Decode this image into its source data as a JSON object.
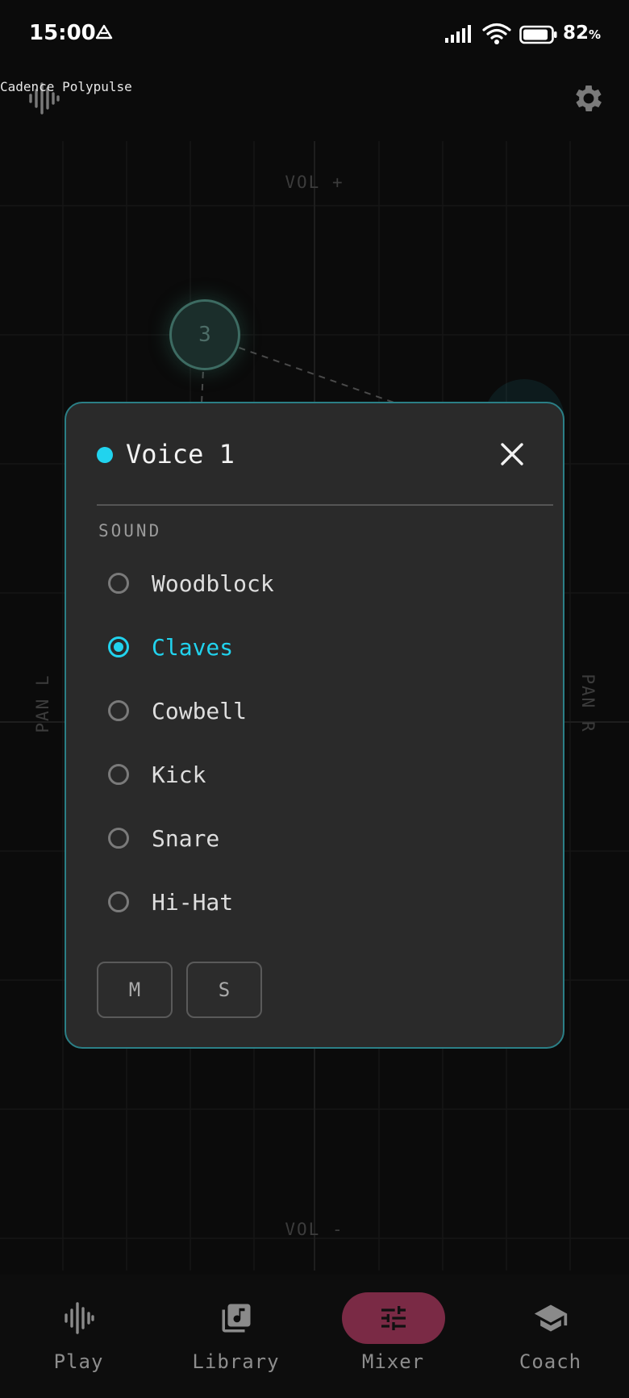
{
  "status_bar": {
    "time": "15:00",
    "battery_percent": "82",
    "battery_unit": "%"
  },
  "header": {
    "title": "Cadence Polypulse"
  },
  "mixer": {
    "axes": {
      "vol_plus": "VOL +",
      "vol_minus": "VOL -",
      "pan_left": "PAN L",
      "pan_right": "PAN R"
    },
    "node_label": "3"
  },
  "dialog": {
    "title": "Voice 1",
    "accent": "#21d3ee",
    "section_label": "SOUND",
    "options": [
      {
        "label": "Woodblock",
        "selected": false
      },
      {
        "label": "Claves",
        "selected": true
      },
      {
        "label": "Cowbell",
        "selected": false
      },
      {
        "label": "Kick",
        "selected": false
      },
      {
        "label": "Snare",
        "selected": false
      },
      {
        "label": "Hi-Hat",
        "selected": false
      }
    ],
    "mute_label": "M",
    "solo_label": "S"
  },
  "nav": {
    "items": [
      {
        "label": "Play",
        "icon": "waveform-icon",
        "active": false
      },
      {
        "label": "Library",
        "icon": "music-library-icon",
        "active": false
      },
      {
        "label": "Mixer",
        "icon": "sliders-icon",
        "active": true
      },
      {
        "label": "Coach",
        "icon": "graduation-cap-icon",
        "active": false
      }
    ]
  }
}
